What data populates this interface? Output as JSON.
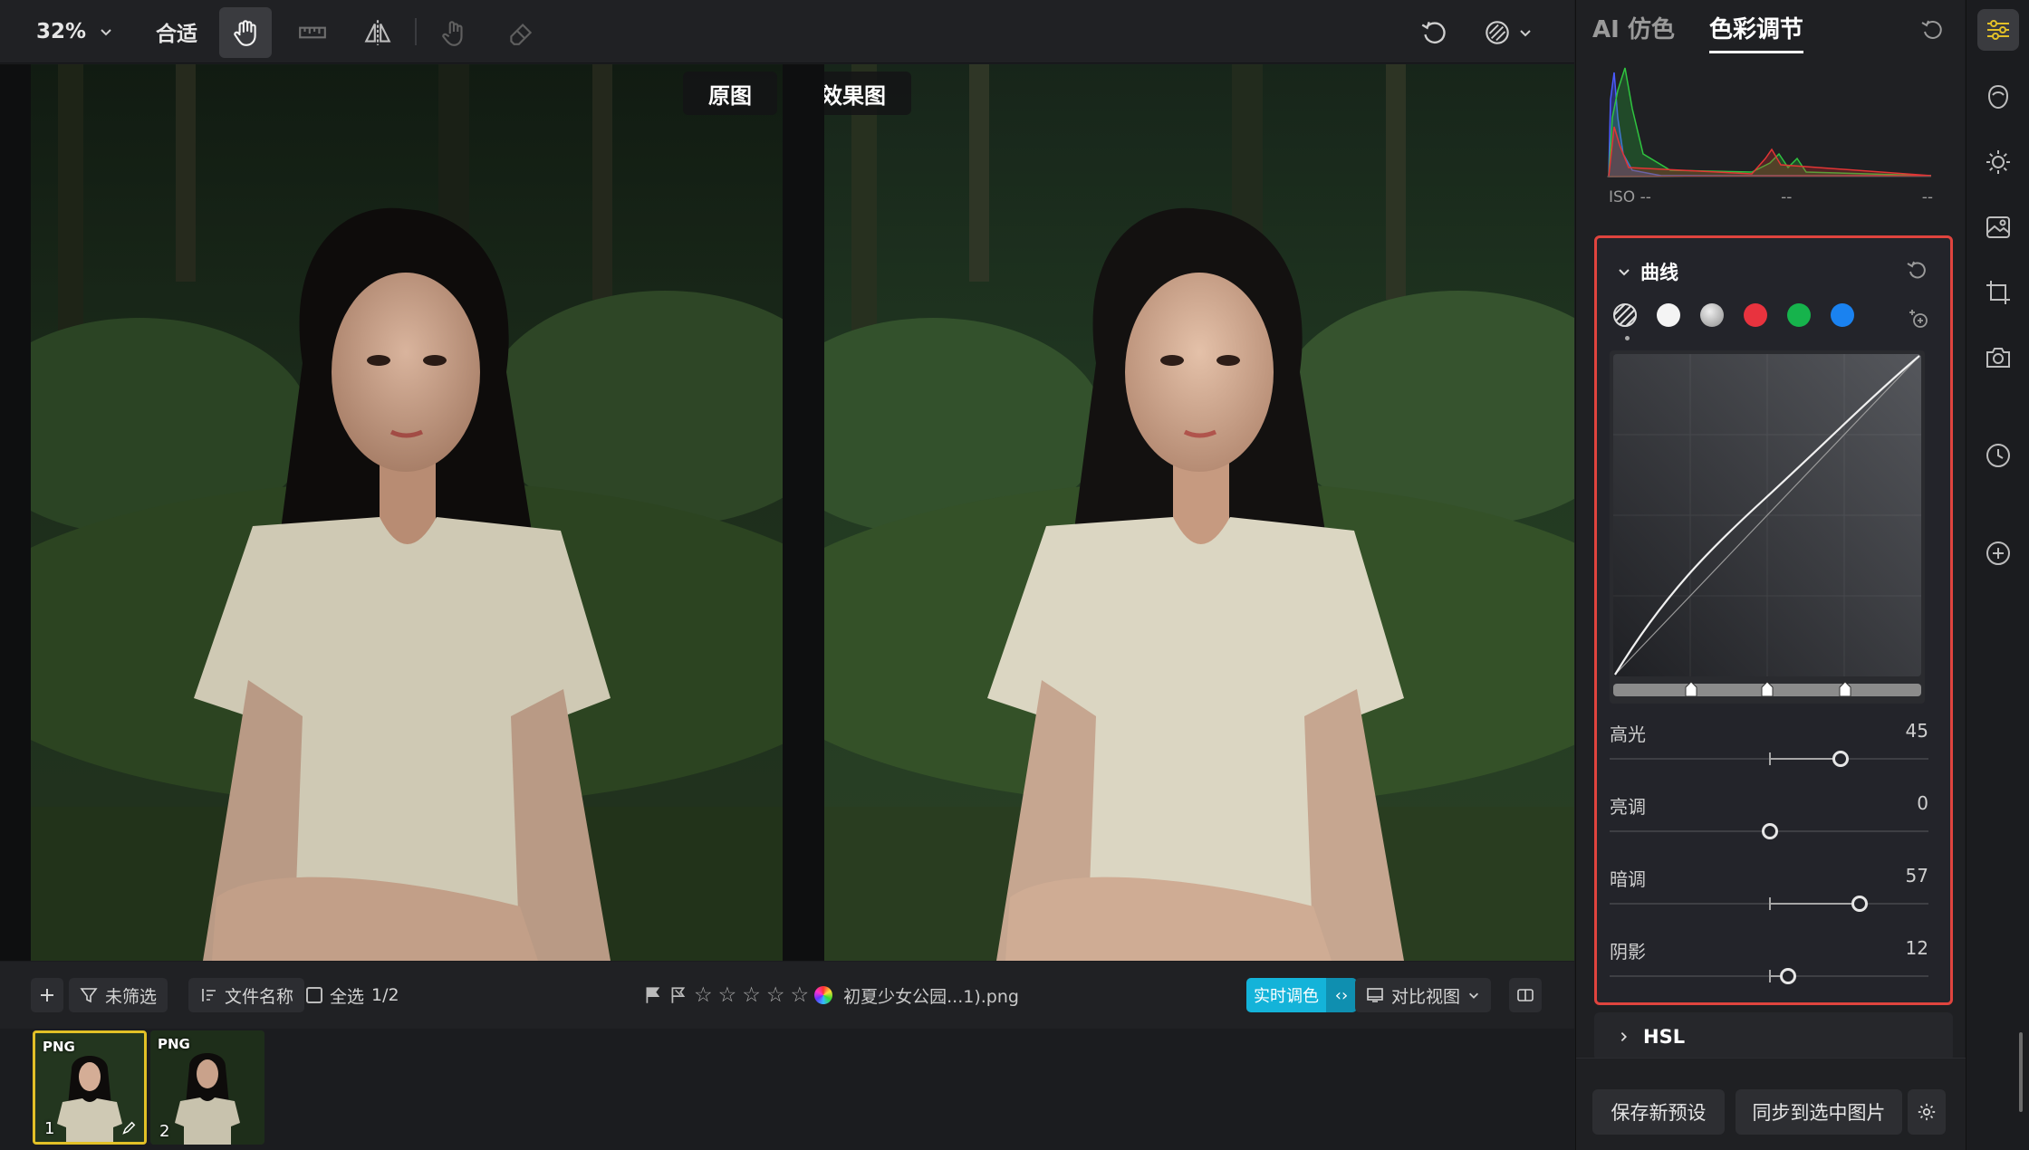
{
  "toolbar": {
    "zoom": "32%",
    "fit_label": "合适",
    "tools": [
      "hand-icon",
      "ruler-icon",
      "flip-icon",
      "touch-icon",
      "eraser-icon"
    ]
  },
  "canvas": {
    "original_label": "原图",
    "effect_label": "效果图"
  },
  "bottombar": {
    "filter_label": "未筛选",
    "sort_label": "文件名称",
    "select_all_label": "全选",
    "select_count": "1/2",
    "filename": "初夏少女公园...1).png",
    "realtime_label": "实时调色",
    "compare_label": "对比视图"
  },
  "filmstrip": {
    "items": [
      {
        "badge": "PNG",
        "num": "1",
        "selected": true
      },
      {
        "badge": "PNG",
        "num": "2",
        "selected": false
      }
    ]
  },
  "panel": {
    "tabs": [
      {
        "label": "AI 仿色",
        "active": false
      },
      {
        "label": "色彩调节",
        "active": true
      }
    ],
    "iso": {
      "label": "ISO --",
      "mid": "--",
      "right": "--"
    },
    "curves": {
      "title": "曲线",
      "channels": [
        "all",
        "white",
        "gray",
        "red",
        "green",
        "blue"
      ],
      "sliders": [
        {
          "name": "高光",
          "value": "45"
        },
        {
          "name": "亮调",
          "value": "0"
        },
        {
          "name": "暗调",
          "value": "57"
        },
        {
          "name": "阴影",
          "value": "12"
        }
      ]
    },
    "hsl_label": "HSL",
    "save_preset_label": "保存新预设",
    "sync_label": "同步到选中图片"
  },
  "colors": {
    "accent": "#14b3d9",
    "highlight_border": "#e0443e",
    "thumb_select": "#e2c027"
  }
}
